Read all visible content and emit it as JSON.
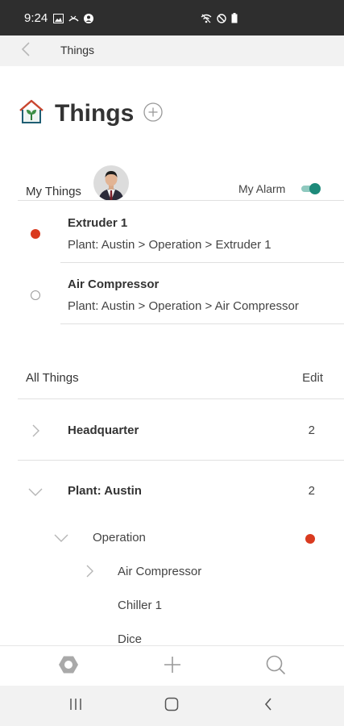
{
  "status_bar": {
    "time": "9:24",
    "left_icons": [
      "image-icon",
      "missed-call-icon",
      "account-icon"
    ],
    "right_icons": [
      "wifi-off-icon",
      "do-not-disturb-icon",
      "battery-icon"
    ]
  },
  "app_bar": {
    "back_icon": "chevron-left-icon",
    "title": "Things"
  },
  "page": {
    "title": "Things",
    "logo_icon": "greenhouse-icon",
    "add_icon": "plus-circle-icon"
  },
  "my_things": {
    "label": "My Things",
    "avatar": "user-avatar",
    "alarm_label": "My Alarm",
    "alarm_enabled": true,
    "items": [
      {
        "name": "Extruder 1",
        "path": "Plant: Austin > Operation > Extruder 1",
        "status": "alarm"
      },
      {
        "name": "Air Compressor",
        "path": "Plant: Austin > Operation > Air Compressor",
        "status": "normal"
      }
    ]
  },
  "all_things": {
    "label": "All Things",
    "edit_label": "Edit",
    "groups": [
      {
        "label": "Headquarter",
        "count": "2",
        "expanded": false
      },
      {
        "label": "Plant: Austin",
        "count": "2",
        "expanded": true
      }
    ],
    "sub_items": [
      {
        "label": "Operation",
        "level": 1,
        "expanded": true,
        "has_alarm": true
      },
      {
        "label": "Air Compressor",
        "level": 2,
        "expandable": true
      },
      {
        "label": "Chiller 1",
        "level": 2,
        "expandable": false
      },
      {
        "label": "Dice",
        "level": 2,
        "expandable": false
      }
    ]
  },
  "bottom_nav": {
    "items": [
      "settings-hexagon-icon",
      "plus-icon",
      "search-icon"
    ]
  },
  "system_nav": {
    "items": [
      "recent-apps-icon",
      "home-icon",
      "back-icon"
    ]
  },
  "colors": {
    "alarm_red": "#d93a1f",
    "toggle_teal": "#1d8a7a",
    "status_bar": "#2e2e2e",
    "app_bar": "#f2f2f2"
  }
}
